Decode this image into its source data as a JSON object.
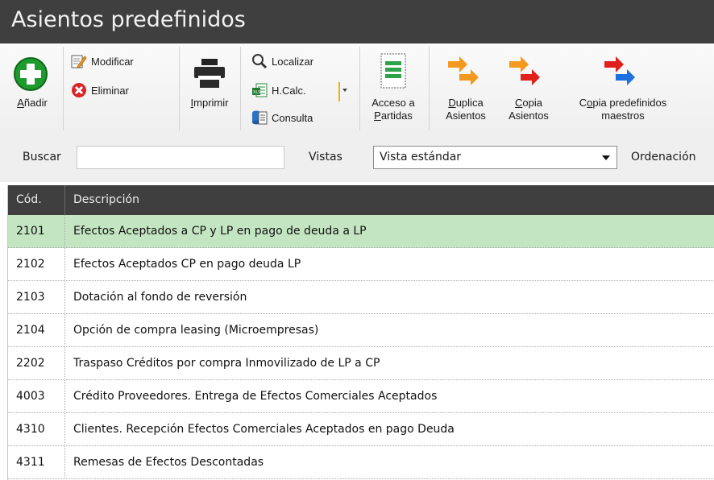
{
  "window": {
    "title": "Asientos predefinidos"
  },
  "toolbar": {
    "anadir": {
      "label": "Añadir",
      "accel": "A",
      "rest": "ñadir"
    },
    "modificar": {
      "accel": "M",
      "rest": "odificar"
    },
    "eliminar": {
      "accel": "E",
      "rest": "liminar"
    },
    "imprimir": {
      "label": "Imprimir",
      "accel": "I",
      "rest": "mprimir"
    },
    "localizar": {
      "accel": "L",
      "rest": "ocalizar"
    },
    "hcalc": {
      "label": "H.Calc."
    },
    "consulta": {
      "pre": "Co",
      "accel": "n",
      "rest": "sulta"
    },
    "acceso": {
      "line1": "Acceso a",
      "accel": "P",
      "rest": "artidas"
    },
    "duplica": {
      "accel": "D",
      "line1rest": "uplica",
      "line2": "Asientos"
    },
    "copia": {
      "accel": "C",
      "line1rest": "opia",
      "line2": "Asientos"
    },
    "copia_maestros": {
      "pre": "C",
      "accel": "o",
      "line1rest": "pia predefinidos",
      "line2": "maestros"
    }
  },
  "filter": {
    "buscar_label": "Buscar",
    "search_value": "",
    "vistas_label": "Vistas",
    "vista_selected": "Vista estándar",
    "ordenacion_label": "Ordenación"
  },
  "grid": {
    "columns": [
      "Cód.",
      "Descripción"
    ],
    "rows": [
      [
        "2101",
        "Efectos Aceptados a CP y LP en pago de deuda a LP"
      ],
      [
        "2102",
        "Efectos Aceptados CP en pago deuda LP"
      ],
      [
        "2103",
        "Dotación al fondo de reversión"
      ],
      [
        "2104",
        "Opción de compra leasing (Microempresas)"
      ],
      [
        "2202",
        "Traspaso Créditos por compra Inmovilizado de LP a CP"
      ],
      [
        "4003",
        "Crédito Proveedores. Entrega de Efectos Comerciales Aceptados"
      ],
      [
        "4310",
        "Clientes. Recepción Efectos Comerciales Aceptados en pago Deuda"
      ],
      [
        "4311",
        "Remesas de Efectos Descontadas"
      ]
    ],
    "selected_row": 0
  },
  "colors": {
    "titlebar": "#3f3f3f",
    "selected_row": "#c4e5c2",
    "arrow_orange": "#f39a1e",
    "arrow_red": "#e0201b",
    "arrow_blue": "#1e6fe0",
    "add_green": "#1e9a2e"
  }
}
